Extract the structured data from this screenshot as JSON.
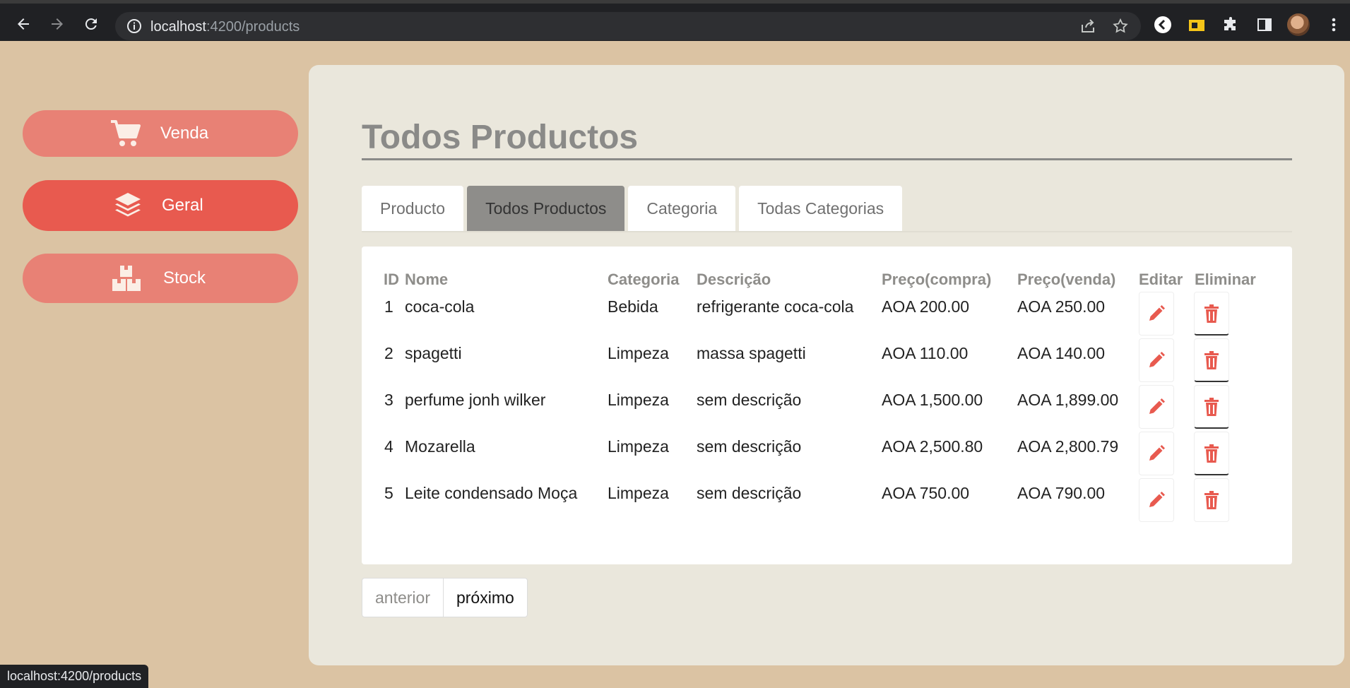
{
  "browser": {
    "url_host": "localhost",
    "url_path": ":4200/products",
    "status_url": "localhost:4200/products"
  },
  "sidebar": {
    "items": [
      {
        "label": "Venda",
        "icon": "cart-icon"
      },
      {
        "label": "Geral",
        "icon": "layers-icon"
      },
      {
        "label": "Stock",
        "icon": "boxes-icon"
      }
    ]
  },
  "main": {
    "title": "Todos Productos",
    "tabs": [
      {
        "label": "Producto"
      },
      {
        "label": "Todos Productos"
      },
      {
        "label": "Categoria"
      },
      {
        "label": "Todas Categorias"
      }
    ],
    "table": {
      "headers": {
        "id": "ID",
        "nome": "Nome",
        "categoria": "Categoria",
        "descricao": "Descrição",
        "compra": "Preço(compra)",
        "venda": "Preço(venda)",
        "editar": "Editar",
        "eliminar": "Eliminar"
      },
      "rows": [
        {
          "id": "1",
          "nome": "coca-cola",
          "categoria": "Bebida",
          "descricao": "refrigerante coca-cola",
          "compra": "AOA 200.00",
          "venda": "AOA 250.00"
        },
        {
          "id": "2",
          "nome": "spagetti",
          "categoria": "Limpeza",
          "descricao": "massa spagetti",
          "compra": "AOA 110.00",
          "venda": "AOA 140.00"
        },
        {
          "id": "3",
          "nome": "perfume jonh wilker",
          "categoria": "Limpeza",
          "descricao": "sem descrição",
          "compra": "AOA 1,500.00",
          "venda": "AOA 1,899.00"
        },
        {
          "id": "4",
          "nome": "Mozarella",
          "categoria": "Limpeza",
          "descricao": "sem descrição",
          "compra": "AOA 2,500.80",
          "venda": "AOA 2,800.79"
        },
        {
          "id": "5",
          "nome": "Leite condensado Moça",
          "categoria": "Limpeza",
          "descricao": "sem descrição",
          "compra": "AOA 750.00",
          "venda": "AOA 790.00"
        }
      ]
    },
    "pager": {
      "prev": "anterior",
      "next": "próximo"
    }
  },
  "colors": {
    "accent": "#e85a4f",
    "accent_light": "#e88175",
    "background": "#dbc3a3",
    "panel": "#eae7dc"
  }
}
